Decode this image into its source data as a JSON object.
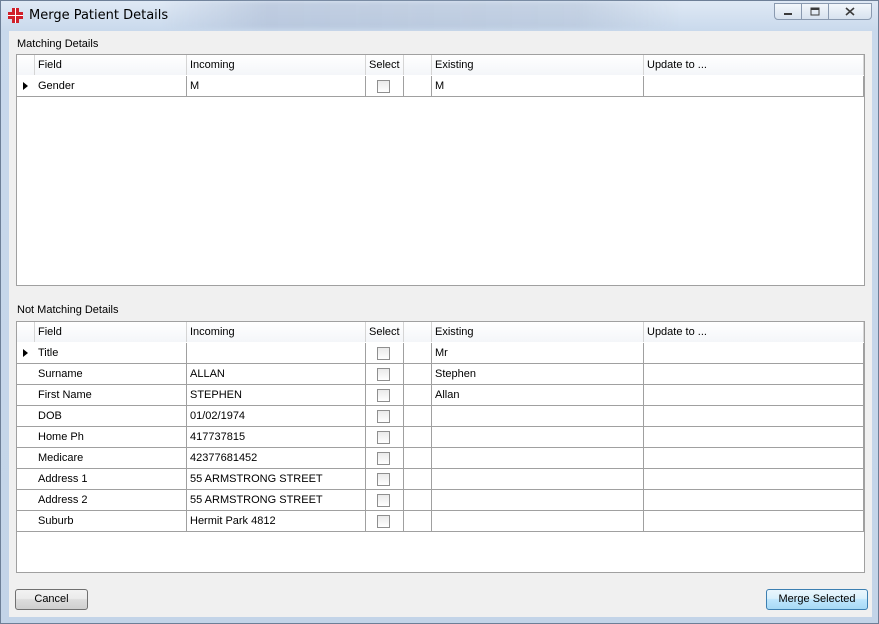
{
  "window": {
    "title": "Merge Patient Details",
    "buttons": {
      "minimize": "minimize-icon",
      "maximize": "maximize-icon",
      "close": "close-icon"
    }
  },
  "matching": {
    "label": "Matching Details",
    "columns": [
      "Field",
      "Incoming",
      "Select",
      "",
      "Existing",
      "Update to ..."
    ],
    "rows": [
      {
        "field": "Gender",
        "incoming": "M",
        "selected": false,
        "existing": "M",
        "update_to": ""
      }
    ]
  },
  "not_matching": {
    "label": "Not Matching Details",
    "columns": [
      "Field",
      "Incoming",
      "Select",
      "",
      "Existing",
      "Update to ..."
    ],
    "rows": [
      {
        "field": "Title",
        "incoming": "",
        "selected": false,
        "existing": "Mr",
        "update_to": ""
      },
      {
        "field": "Surname",
        "incoming": "ALLAN",
        "selected": false,
        "existing": "Stephen",
        "update_to": ""
      },
      {
        "field": "First Name",
        "incoming": "STEPHEN",
        "selected": false,
        "existing": "Allan",
        "update_to": ""
      },
      {
        "field": "DOB",
        "incoming": "01/02/1974",
        "selected": false,
        "existing": "",
        "update_to": ""
      },
      {
        "field": "Home Ph",
        "incoming": "417737815",
        "selected": false,
        "existing": "",
        "update_to": ""
      },
      {
        "field": "Medicare",
        "incoming": "42377681452",
        "selected": false,
        "existing": "",
        "update_to": ""
      },
      {
        "field": "Address 1",
        "incoming": "55 ARMSTRONG STREET",
        "selected": false,
        "existing": "",
        "update_to": ""
      },
      {
        "field": "Address 2",
        "incoming": "55 ARMSTRONG STREET",
        "selected": false,
        "existing": "",
        "update_to": ""
      },
      {
        "field": "Suburb",
        "incoming": "Hermit Park 4812",
        "selected": false,
        "existing": "",
        "update_to": ""
      }
    ]
  },
  "footer": {
    "cancel_label": "Cancel",
    "merge_label": "Merge Selected"
  },
  "colors": {
    "accent": "#3c7fb1",
    "frame": "#c3d4e8",
    "icon_red": "#d0202a"
  }
}
